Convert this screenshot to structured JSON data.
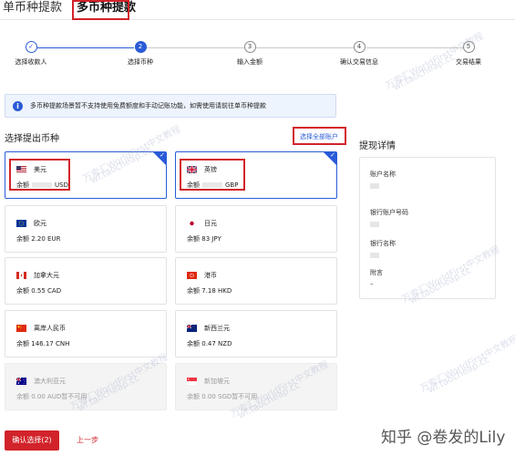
{
  "tabs": [
    {
      "label": "单币种提款"
    },
    {
      "label": "多币种提款"
    }
  ],
  "steps": [
    {
      "num": "✓",
      "label": "选择收款人",
      "state": "done"
    },
    {
      "num": "2",
      "label": "选择币种",
      "state": "active"
    },
    {
      "num": "3",
      "label": "输入金额",
      "state": "todo"
    },
    {
      "num": "4",
      "label": "确认交易信息",
      "state": "todo"
    },
    {
      "num": "5",
      "label": "交易结果",
      "state": "todo"
    }
  ],
  "banner": {
    "icon": "info-icon",
    "text": "多币种提款场景暂不支持使用免费额度和手动记账功能，如需使用请前往单币种提款"
  },
  "section_title": "选择提出币种",
  "select_all_link": "选择全部账户",
  "balance_prefix": "余额",
  "currencies": [
    {
      "name": "美元",
      "balance": "USD",
      "flag": "us-flag-icon",
      "selected": true,
      "disabled": false,
      "hidden_amount": true
    },
    {
      "name": "英镑",
      "balance": "GBP",
      "flag": "uk-flag-icon",
      "selected": true,
      "disabled": false,
      "hidden_amount": true
    },
    {
      "name": "欧元",
      "balance": "2.20 EUR",
      "flag": "eu-flag-icon",
      "selected": false,
      "disabled": false
    },
    {
      "name": "日元",
      "balance": "83 JPY",
      "flag": "jp-flag-icon",
      "selected": false,
      "disabled": false
    },
    {
      "name": "加拿大元",
      "balance": "0.55 CAD",
      "flag": "ca-flag-icon",
      "selected": false,
      "disabled": false
    },
    {
      "name": "港币",
      "balance": "7.18 HKD",
      "flag": "hk-flag-icon",
      "selected": false,
      "disabled": false
    },
    {
      "name": "离岸人民币",
      "balance": "146.17 CNH",
      "flag": "cn-flag-icon",
      "selected": false,
      "disabled": false
    },
    {
      "name": "新西兰元",
      "balance": "0.47 NZD",
      "flag": "nz-flag-icon",
      "selected": false,
      "disabled": false
    },
    {
      "name": "澳大利亚元",
      "balance": "0.00 AUD暂不可用",
      "flag": "au-flag-icon",
      "selected": false,
      "disabled": true
    },
    {
      "name": "新加坡元",
      "balance": "0.00 SGD暂不可用",
      "flag": "sg-flag-icon",
      "selected": false,
      "disabled": true
    }
  ],
  "details": {
    "title": "提现详情",
    "fields": [
      {
        "label": "账户名称"
      },
      {
        "label": "银行账户号码"
      },
      {
        "label": "银行名称"
      },
      {
        "label": "附言",
        "value": "–"
      }
    ]
  },
  "footer": {
    "confirm_label": "确认选择(2)",
    "back_label": "上一步"
  },
  "watermark": {
    "line1": "万索汇WorldFirst中文教程",
    "line2": "wf.taocheap.cc",
    "zhihu": "知乎 @卷发的Lily"
  },
  "colors": {
    "brand_red": "#d2232a",
    "accent_blue": "#2a5bd7"
  }
}
